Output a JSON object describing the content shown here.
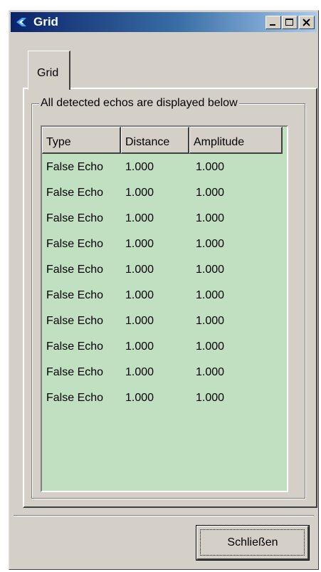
{
  "window": {
    "title": "Grid",
    "controls": {
      "minimize": "minimize",
      "maximize": "maximize",
      "close": "close"
    }
  },
  "tabs": [
    {
      "label": "Grid",
      "active": true
    }
  ],
  "group": {
    "label": "All detected echos are displayed below"
  },
  "grid": {
    "columns": [
      "Type",
      "Distance",
      "Amplitude"
    ],
    "rows": [
      [
        "False Echo",
        "1.000",
        "1.000"
      ],
      [
        "False Echo",
        "1.000",
        "1.000"
      ],
      [
        "False Echo",
        "1.000",
        "1.000"
      ],
      [
        "False Echo",
        "1.000",
        "1.000"
      ],
      [
        "False Echo",
        "1.000",
        "1.000"
      ],
      [
        "False Echo",
        "1.000",
        "1.000"
      ],
      [
        "False Echo",
        "1.000",
        "1.000"
      ],
      [
        "False Echo",
        "1.000",
        "1.000"
      ],
      [
        "False Echo",
        "1.000",
        "1.000"
      ],
      [
        "False Echo",
        "1.000",
        "1.000"
      ]
    ],
    "background_color": "#c1dfc1"
  },
  "footer": {
    "close_label": "Schließen"
  },
  "icons": {
    "app": "app-icon"
  }
}
